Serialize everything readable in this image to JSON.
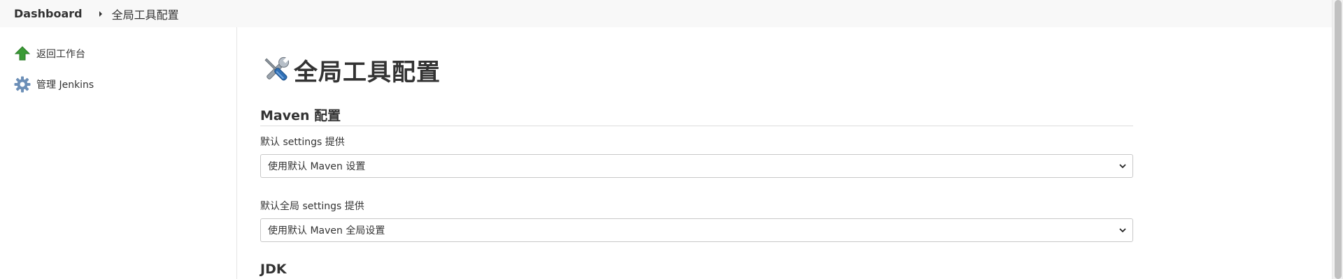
{
  "breadcrumb": {
    "home": "Dashboard",
    "current": "全局工具配置"
  },
  "sidebar": {
    "items": [
      {
        "label": "返回工作台",
        "icon": "up-arrow-icon"
      },
      {
        "label": "管理 Jenkins",
        "icon": "gear-icon"
      }
    ]
  },
  "main": {
    "title": "全局工具配置",
    "title_icon": "tools-icon",
    "maven": {
      "heading": "Maven 配置",
      "settings_label": "默认 settings 提供",
      "settings_value": "使用默认 Maven 设置",
      "global_settings_label": "默认全局 settings 提供",
      "global_settings_value": "使用默认 Maven 全局设置"
    },
    "jdk": {
      "heading": "JDK"
    }
  },
  "colors": {
    "breadcrumb_bg": "#f8f8f8",
    "arrow_green": "#3a9b35",
    "gear_blue": "#6c8fb7",
    "border": "#c8c8c8"
  }
}
